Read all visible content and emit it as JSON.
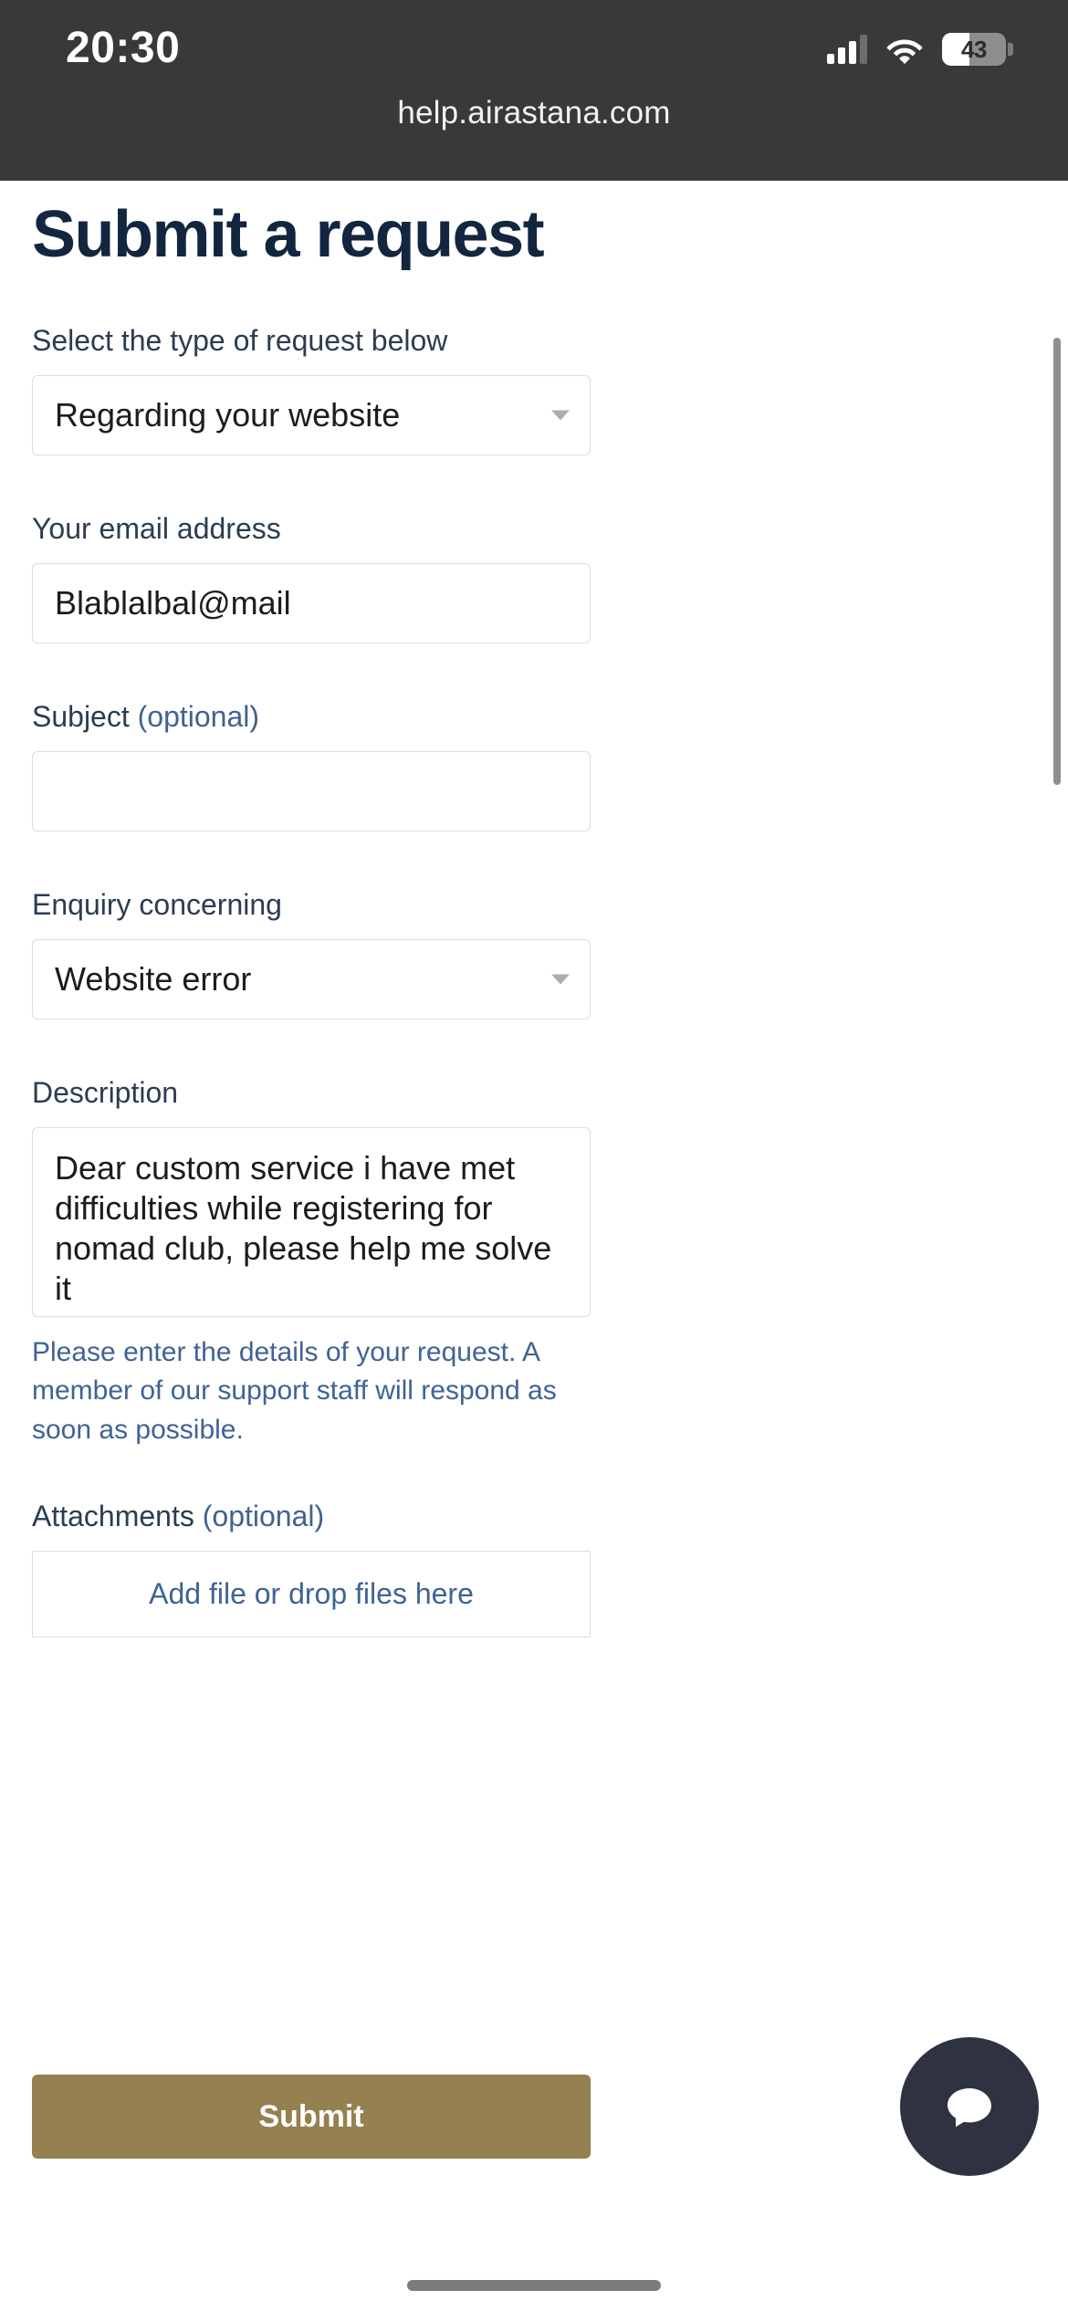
{
  "status_bar": {
    "time": "20:30",
    "battery_level": "43",
    "cellular_icon": "cellular-bars-icon",
    "wifi_icon": "wifi-icon",
    "battery_icon": "battery-icon"
  },
  "browser": {
    "url": "help.airastana.com"
  },
  "page": {
    "title": "Submit a request"
  },
  "form": {
    "request_type": {
      "label": "Select the type of request below",
      "value": "Regarding your website",
      "caret_icon": "chevron-down-icon"
    },
    "email": {
      "label": "Your email address",
      "value": "Blablalbal@mail",
      "placeholder": ""
    },
    "subject": {
      "label": "Subject",
      "optional": "(optional)",
      "value": "",
      "placeholder": ""
    },
    "enquiry": {
      "label": "Enquiry concerning",
      "value": "Website error",
      "caret_icon": "chevron-down-icon"
    },
    "description": {
      "label": "Description",
      "value": "Dear custom service i have met difficulties while registering for nomad club, please help me solve it",
      "hint": "Please enter the details of your request. A member of our support staff will respond as soon as possible."
    },
    "attachments": {
      "label": "Attachments",
      "optional": "(optional)",
      "drop_text": "Add file or drop files here"
    },
    "submit_label": "Submit"
  },
  "chat_widget": {
    "icon": "chat-bubble-icon"
  },
  "colors": {
    "brand_gold": "#95804f",
    "heading_navy": "#12263f",
    "link_blue": "#3f6394",
    "chat_fab": "#2e3241",
    "chrome_dark": "#393939"
  }
}
